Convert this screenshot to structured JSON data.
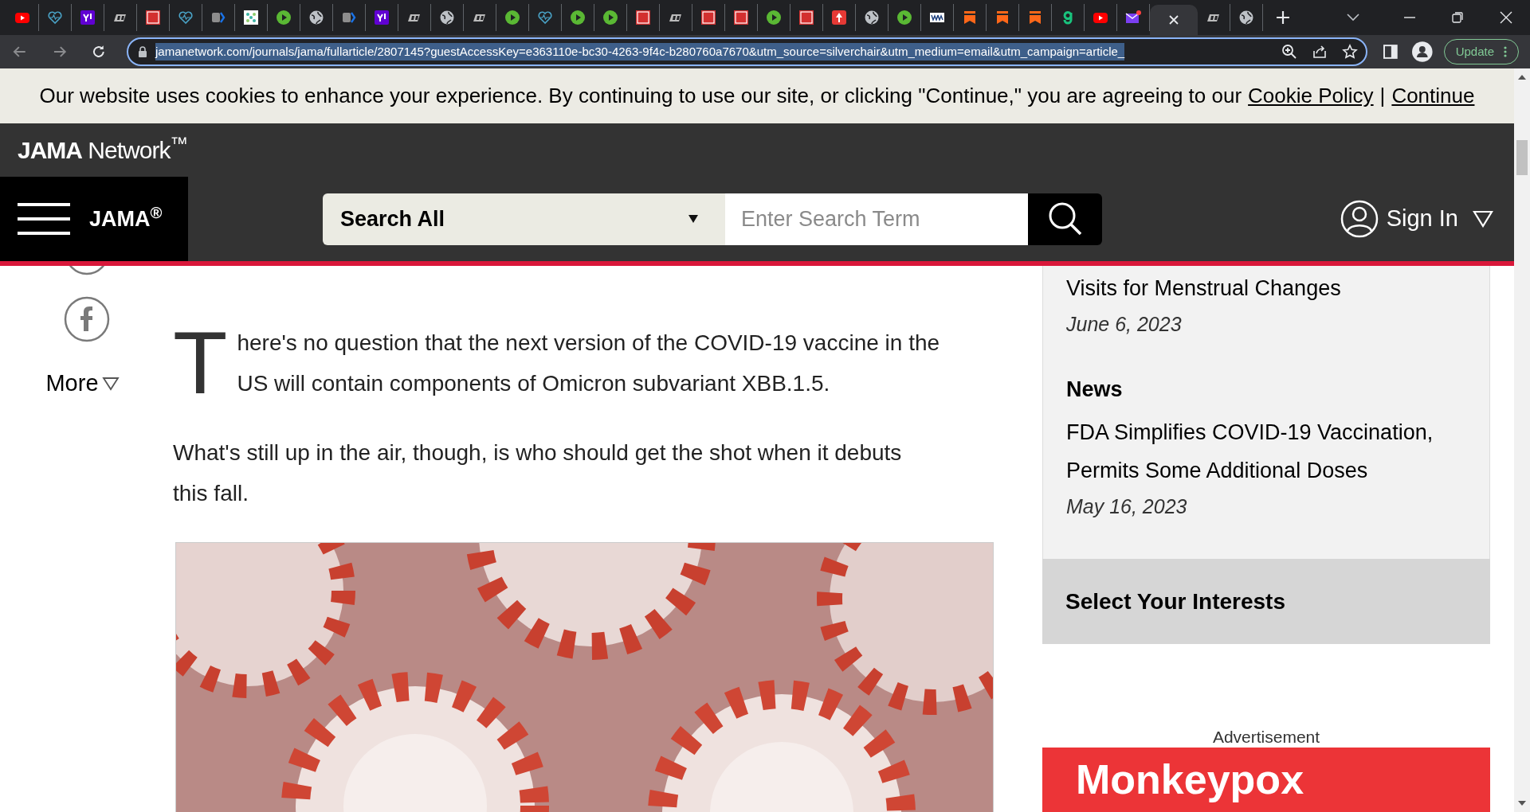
{
  "browser": {
    "tabs": [
      {
        "kind": "youtube",
        "selected": false
      },
      {
        "kind": "heart",
        "selected": false
      },
      {
        "kind": "yahoo",
        "selected": false
      },
      {
        "kind": "dr",
        "selected": false
      },
      {
        "kind": "bi",
        "selected": false
      },
      {
        "kind": "heart",
        "selected": false
      },
      {
        "kind": "arrow",
        "selected": false
      },
      {
        "kind": "grid",
        "selected": false
      },
      {
        "kind": "play",
        "selected": false
      },
      {
        "kind": "globe",
        "selected": false
      },
      {
        "kind": "arrow",
        "selected": false
      },
      {
        "kind": "yahoo",
        "selected": false
      },
      {
        "kind": "dr",
        "selected": false
      },
      {
        "kind": "globe",
        "selected": false
      },
      {
        "kind": "dr",
        "selected": false
      },
      {
        "kind": "play",
        "selected": false
      },
      {
        "kind": "heart",
        "selected": false
      },
      {
        "kind": "play",
        "selected": false
      },
      {
        "kind": "play",
        "selected": false
      },
      {
        "kind": "bi",
        "selected": false
      },
      {
        "kind": "dr",
        "selected": false
      },
      {
        "kind": "bi",
        "selected": false
      },
      {
        "kind": "bi",
        "selected": false
      },
      {
        "kind": "play",
        "selected": false
      },
      {
        "kind": "bi",
        "selected": false
      },
      {
        "kind": "mic",
        "selected": false
      },
      {
        "kind": "globe",
        "selected": false
      },
      {
        "kind": "play",
        "selected": false
      },
      {
        "kind": "ww",
        "selected": false
      },
      {
        "kind": "bookmark",
        "selected": false
      },
      {
        "kind": "bookmark",
        "selected": false
      },
      {
        "kind": "bookmark",
        "selected": false
      },
      {
        "kind": "g",
        "selected": false
      },
      {
        "kind": "youtube",
        "selected": false
      },
      {
        "kind": "mail",
        "selected": false
      },
      {
        "selected": true
      },
      {
        "kind": "dr",
        "selected": false
      },
      {
        "kind": "globe",
        "selected": false
      }
    ],
    "address": "jamanetwork.com/journals/jama/fullarticle/2807145?guestAccessKey=e363110e-bc30-4263-9f4c-b280760a7670&utm_source=silverchair&utm_medium=email&utm_campaign=article_",
    "update_button": "Update"
  },
  "cookie_banner": {
    "text": "Our website uses cookies to enhance your experience. By continuing to use our site, or clicking \"Continue,\" you are agreeing to our",
    "policy_link": "Cookie Policy",
    "separator": "|",
    "continue_link": "Continue"
  },
  "network_logo": "**JAMA** Network$^{™}$",
  "nav": {
    "journal": "JAMA$^{®}$",
    "search_scope": "Search All",
    "search_placeholder": "Enter Search Term",
    "sign_in": "Sign In"
  },
  "share": {
    "more": "More"
  },
  "article": {
    "drop_cap": "T",
    "lead": "here's no question that the next version of the COVID-19 vaccine in the US will contain components of Omicron subvariant XBB.1.5.",
    "paragraphs": [
      "What's still up in the air, though, is who should get the shot when it debuts this fall."
    ],
    "image": {
      "kind": "picture"
    }
  },
  "sidebar": {
    "items": [
      {
        "title": "Visits for Menstrual Changes",
        "date": "June 6, 2023"
      },
      {
        "label": "News",
        "title": "FDA Simplifies COVID-19 Vaccination, Permits Some Additional Doses",
        "date": "May 16, 2023"
      }
    ],
    "interests": "Select Your Interests",
    "ad_label": "Advertisement",
    "ad_text": "Monkeypox"
  }
}
